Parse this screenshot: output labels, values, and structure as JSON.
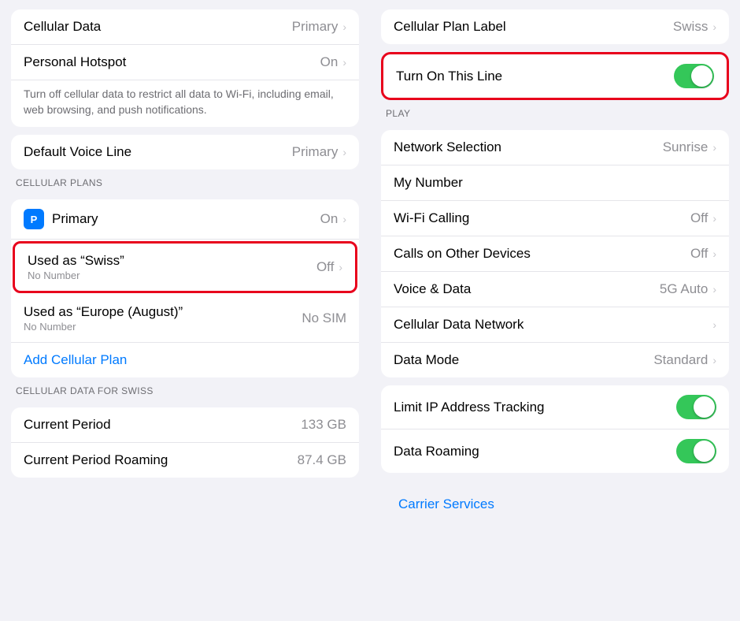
{
  "left": {
    "rows_top": [
      {
        "label": "Cellular Data",
        "value": "Primary",
        "chevron": true
      },
      {
        "label": "Personal Hotspot",
        "value": "On",
        "chevron": true
      }
    ],
    "note": "Turn off cellular data to restrict all data to Wi-Fi, including email, web browsing, and push notifications.",
    "rows_voice": [
      {
        "label": "Default Voice Line",
        "value": "Primary",
        "chevron": true
      }
    ],
    "cellular_plans_label": "CELLULAR PLANS",
    "plans": [
      {
        "icon": "P",
        "label": "Primary",
        "value": "On",
        "chevron": true,
        "highlight": false
      },
      {
        "icon": null,
        "label": "Used as “Swiss”",
        "sublabel": "No Number",
        "value": "Off",
        "chevron": true,
        "highlight": true
      },
      {
        "icon": null,
        "label": "Used as “Europe (August)”",
        "sublabel": "No Number",
        "value": "No SIM",
        "chevron": false,
        "highlight": false
      }
    ],
    "add_plan": "Add Cellular Plan",
    "data_for_label": "CELLULAR DATA FOR SWISS",
    "data_rows": [
      {
        "label": "Current Period",
        "value": "133 GB"
      },
      {
        "label": "Current Period Roaming",
        "value": "87.4 GB"
      }
    ]
  },
  "right": {
    "rows_top": [
      {
        "label": "Cellular Plan Label",
        "value": "Swiss",
        "chevron": true,
        "highlight": false
      }
    ],
    "turn_on_line": {
      "label": "Turn On This Line",
      "toggle": "on",
      "highlight": true
    },
    "play_label": "PLAY",
    "play_rows": [
      {
        "label": "Network Selection",
        "value": "Sunrise",
        "chevron": true
      },
      {
        "label": "My Number",
        "value": "",
        "chevron": false
      },
      {
        "label": "Wi-Fi Calling",
        "value": "Off",
        "chevron": true
      },
      {
        "label": "Calls on Other Devices",
        "value": "Off",
        "chevron": true
      },
      {
        "label": "Voice & Data",
        "value": "5G Auto",
        "chevron": true
      },
      {
        "label": "Cellular Data Network",
        "value": "",
        "chevron": true
      },
      {
        "label": "Data Mode",
        "value": "Standard",
        "chevron": true
      }
    ],
    "bottom_rows": [
      {
        "label": "Limit IP Address Tracking",
        "toggle": "on"
      },
      {
        "label": "Data Roaming",
        "toggle": "on"
      }
    ],
    "carrier_services": "Carrier Services"
  }
}
